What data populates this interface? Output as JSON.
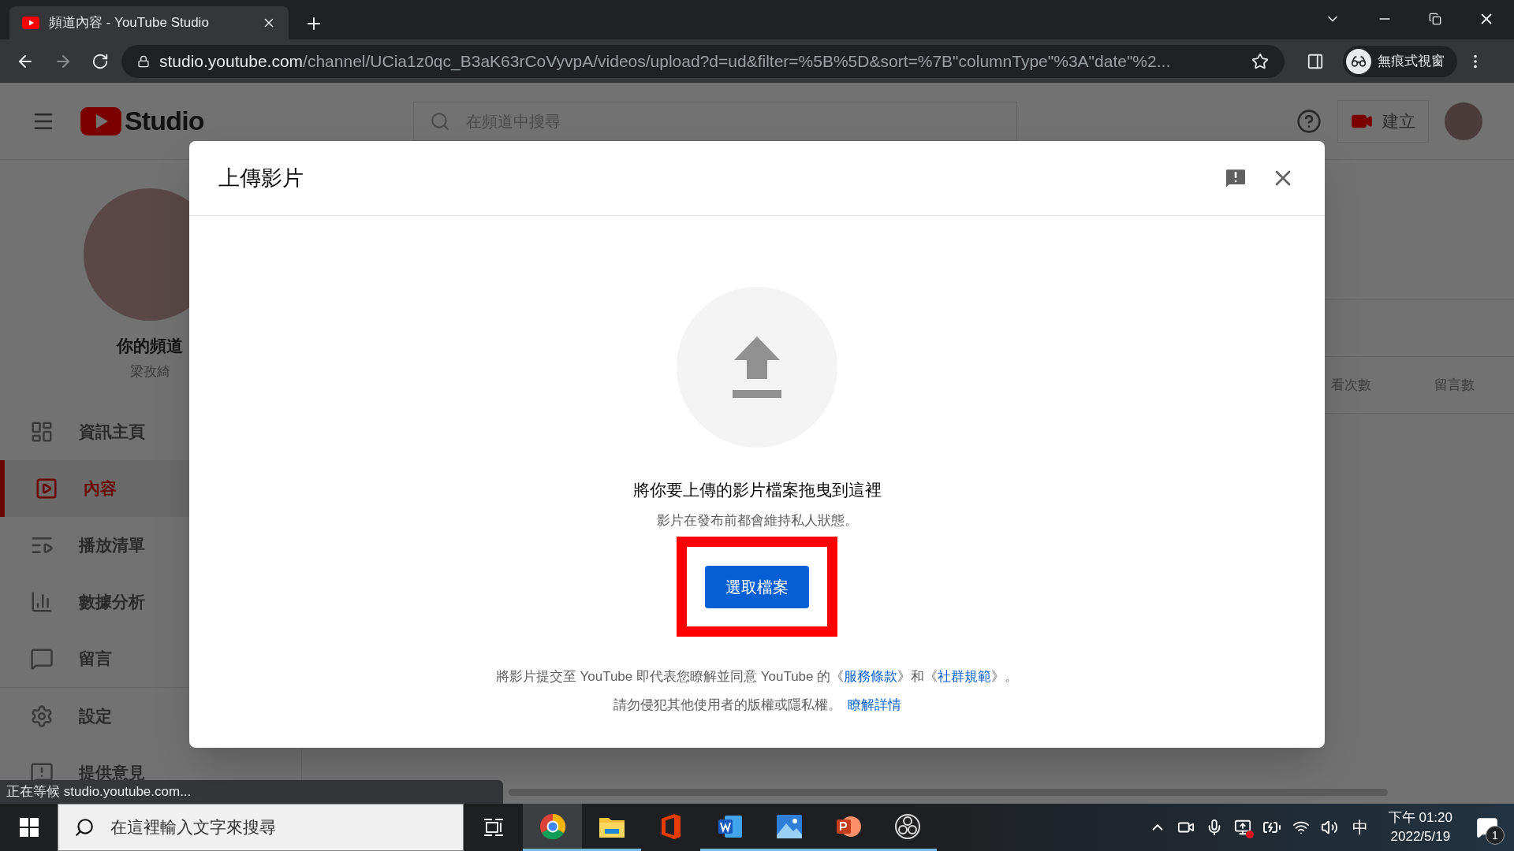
{
  "browser": {
    "tab": {
      "title": "頻道內容 - YouTube Studio"
    },
    "url": {
      "host": "studio.youtube.com",
      "path": "/channel/UCia1z0qc_B3aK63rCoVyvpA/videos/upload?d=ud&filter=%5B%5D&sort=%7B\"columnType\"%3A\"date\"%2..."
    },
    "incognito_label": "無痕式視窗"
  },
  "studio_header": {
    "logo_text": "Studio",
    "search_placeholder": "在頻道中搜尋",
    "create_label": "建立"
  },
  "sidebar": {
    "channel_title": "你的頻道",
    "channel_name": "梁孜綺",
    "items": [
      {
        "kind": "dashboard",
        "label": "資訊主頁",
        "selected": false
      },
      {
        "kind": "content",
        "label": "內容",
        "selected": true
      },
      {
        "kind": "playlists",
        "label": "播放清單",
        "selected": false
      },
      {
        "kind": "analytics",
        "label": "數據分析",
        "selected": false
      },
      {
        "kind": "comments",
        "label": "留言",
        "selected": false
      },
      {
        "kind": "settings",
        "label": "設定",
        "selected": false
      },
      {
        "kind": "feedback",
        "label": "提供意見",
        "selected": false
      }
    ]
  },
  "background_table": {
    "columns": [
      "看次數",
      "留言數"
    ]
  },
  "dialog": {
    "title": "上傳影片",
    "drop_title": "將你要上傳的影片檔案拖曳到這裡",
    "drop_subtitle": "影片在發布前都會維持私人狀態。",
    "select_button": "選取檔案",
    "terms": [
      {
        "text": "將影片提交至 YouTube 即代表您瞭解並同意 YouTube 的《",
        "link": false
      },
      {
        "text": "服務條款",
        "link": true
      },
      {
        "text": "》和《",
        "link": false
      },
      {
        "text": "社群規範",
        "link": true
      },
      {
        "text": "》。",
        "link": false
      }
    ],
    "notice": "請勿侵犯其他使用者的版權或隱私權。",
    "learn_more": "瞭解詳情"
  },
  "status_text": "正在等候 studio.youtube.com...",
  "taskbar": {
    "search_placeholder": "在這裡輸入文字來搜尋",
    "apps": [
      {
        "kind": "chrome",
        "selected": true,
        "running": true
      },
      {
        "kind": "explorer",
        "selected": false,
        "running": true
      },
      {
        "kind": "office",
        "selected": false,
        "running": false
      },
      {
        "kind": "word",
        "selected": false,
        "running": true
      },
      {
        "kind": "photos",
        "selected": false,
        "running": true
      },
      {
        "kind": "powerpoint",
        "selected": false,
        "running": true
      },
      {
        "kind": "obs",
        "selected": false,
        "running": true
      }
    ],
    "ime": "中",
    "time": "下午 01:20",
    "date": "2022/5/19",
    "notification_count": "1"
  }
}
